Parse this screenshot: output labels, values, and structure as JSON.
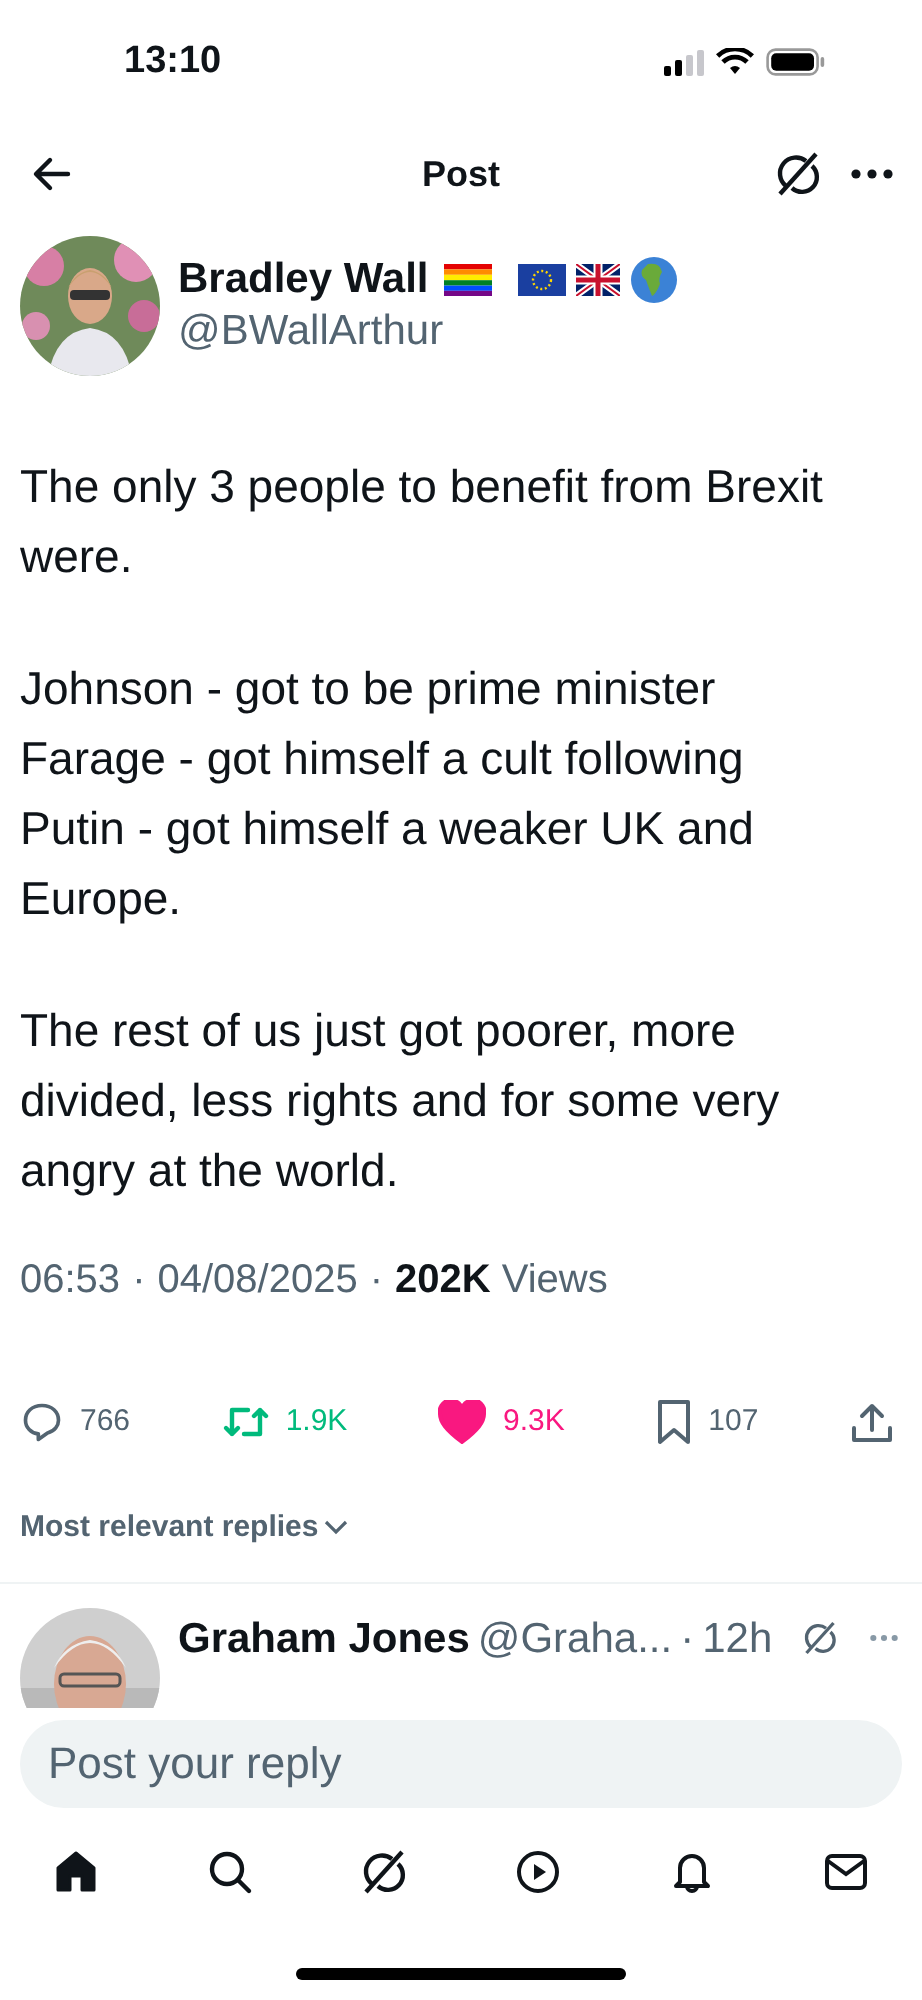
{
  "status_bar": {
    "time": "13:10"
  },
  "header": {
    "title": "Post"
  },
  "post": {
    "author": "Bradley Wall",
    "handle": "@BWallArthur",
    "paragraphs": [
      "The only 3 people to benefit from Brexit were.",
      "Johnson - got to be prime minister\nFarage - got himself a cult following\nPutin - got himself a weaker UK and Europe.",
      "The rest of us just got poorer, more divided, less rights and for some very angry at the world."
    ],
    "time": "06:53",
    "separators": [
      "·",
      "·"
    ],
    "date": "04/08/2025",
    "views_count": "202K",
    "views_label": "Views"
  },
  "actions": [
    {
      "kind": "reply",
      "count": "766",
      "active": false
    },
    {
      "kind": "repost",
      "count": "1.9K",
      "active": true
    },
    {
      "kind": "like",
      "count": "9.3K",
      "active": true
    },
    {
      "kind": "bookmark",
      "count": "107",
      "active": false
    },
    {
      "kind": "share"
    }
  ],
  "replies_sort": "Most relevant replies",
  "replies": [
    {
      "author": "Graham Jones",
      "handle": "@Graha...",
      "separator": "·",
      "age": "12h"
    }
  ],
  "composer": {
    "placeholder": "Post your reply"
  },
  "tab_bar": [
    {
      "kind": "home",
      "selected": true
    },
    {
      "kind": "search",
      "selected": false
    },
    {
      "kind": "grok",
      "selected": false
    },
    {
      "kind": "video",
      "selected": false
    },
    {
      "kind": "notifications",
      "selected": false
    },
    {
      "kind": "messages",
      "selected": false
    }
  ]
}
